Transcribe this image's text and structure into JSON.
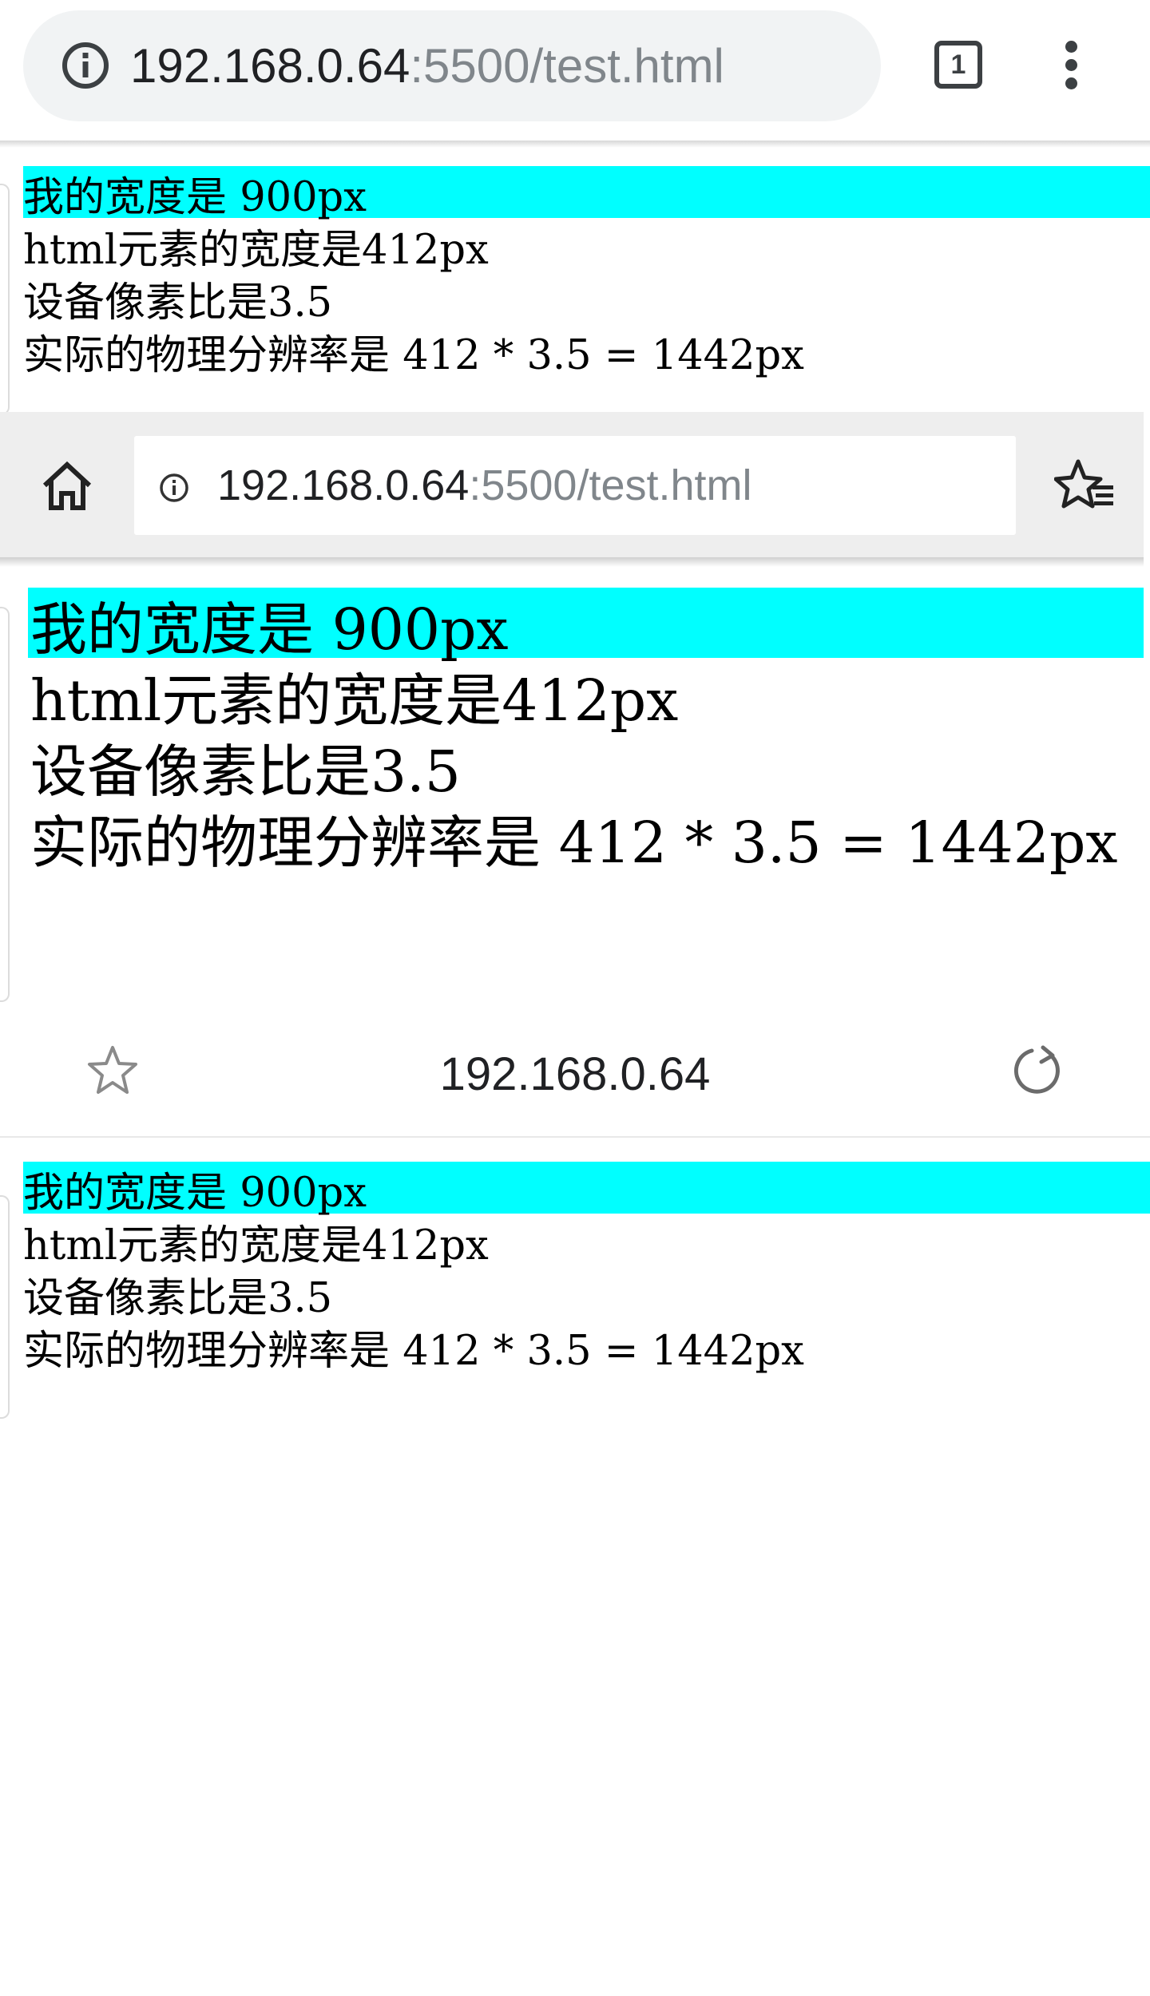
{
  "browser1": {
    "url_host": "192.168.0.64",
    "url_rest": ":5500/test.html",
    "tab_count": "1",
    "icons": [
      "info-icon",
      "tab-switcher-icon",
      "more-vert-icon"
    ]
  },
  "browser2": {
    "url_host": "192.168.0.64",
    "url_rest": ":5500/test.html",
    "icons": [
      "home-icon",
      "info-icon",
      "star-list-icon"
    ]
  },
  "browser3": {
    "title": "192.168.0.64",
    "icons": [
      "star-icon",
      "reload-icon"
    ]
  },
  "page": {
    "line1": "我的宽度是 900px",
    "line2": "html元素的宽度是412px",
    "line3": "设备像素比是3.5",
    "line4": "实际的物理分辨率是 412 * 3.5 = 1442px",
    "highlight_color": "#00ffff"
  }
}
